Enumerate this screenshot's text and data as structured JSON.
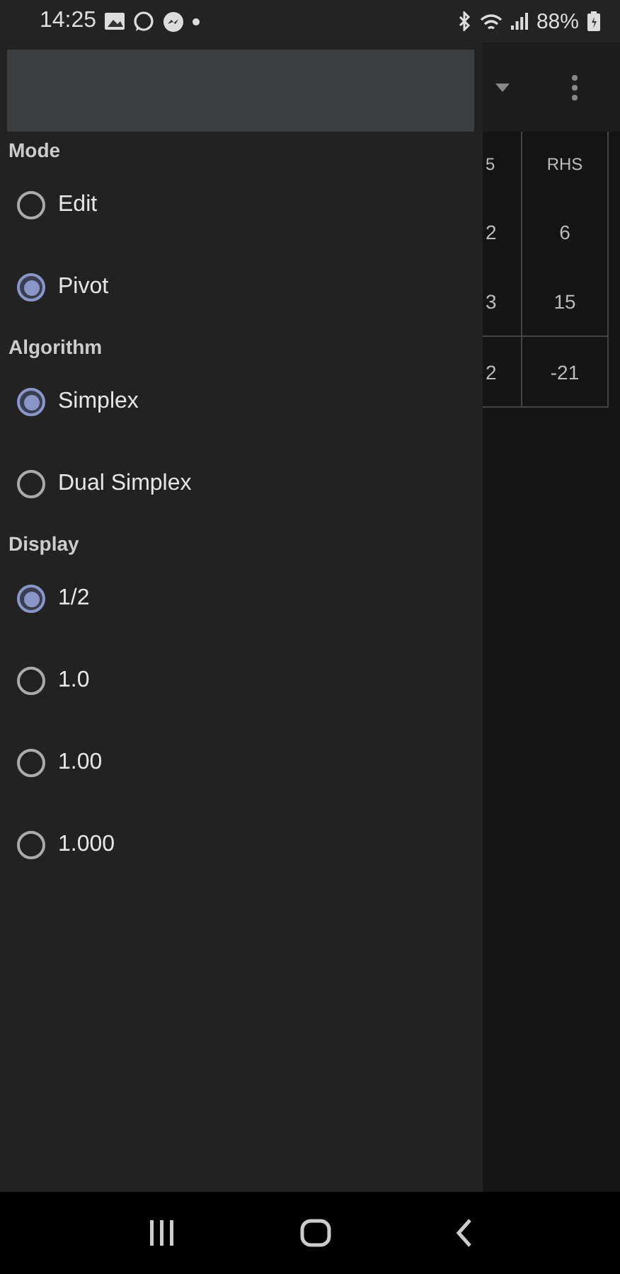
{
  "status_bar": {
    "time": "14:25",
    "battery": "88%"
  },
  "drawer": {
    "sections": [
      {
        "title": "Mode",
        "options": [
          {
            "label": "Edit",
            "selected": false
          },
          {
            "label": "Pivot",
            "selected": true
          }
        ]
      },
      {
        "title": "Algorithm",
        "options": [
          {
            "label": "Simplex",
            "selected": true
          },
          {
            "label": "Dual Simplex",
            "selected": false
          }
        ]
      },
      {
        "title": "Display",
        "options": [
          {
            "label": "1/2",
            "selected": true
          },
          {
            "label": "1.0",
            "selected": false
          },
          {
            "label": "1.00",
            "selected": false
          },
          {
            "label": "1.000",
            "selected": false
          }
        ]
      }
    ]
  },
  "table": {
    "columns": [
      "5",
      "RHS"
    ],
    "rows": [
      [
        "2",
        "6"
      ],
      [
        "3",
        "15"
      ]
    ],
    "objective_row": [
      "2",
      "-21"
    ]
  }
}
